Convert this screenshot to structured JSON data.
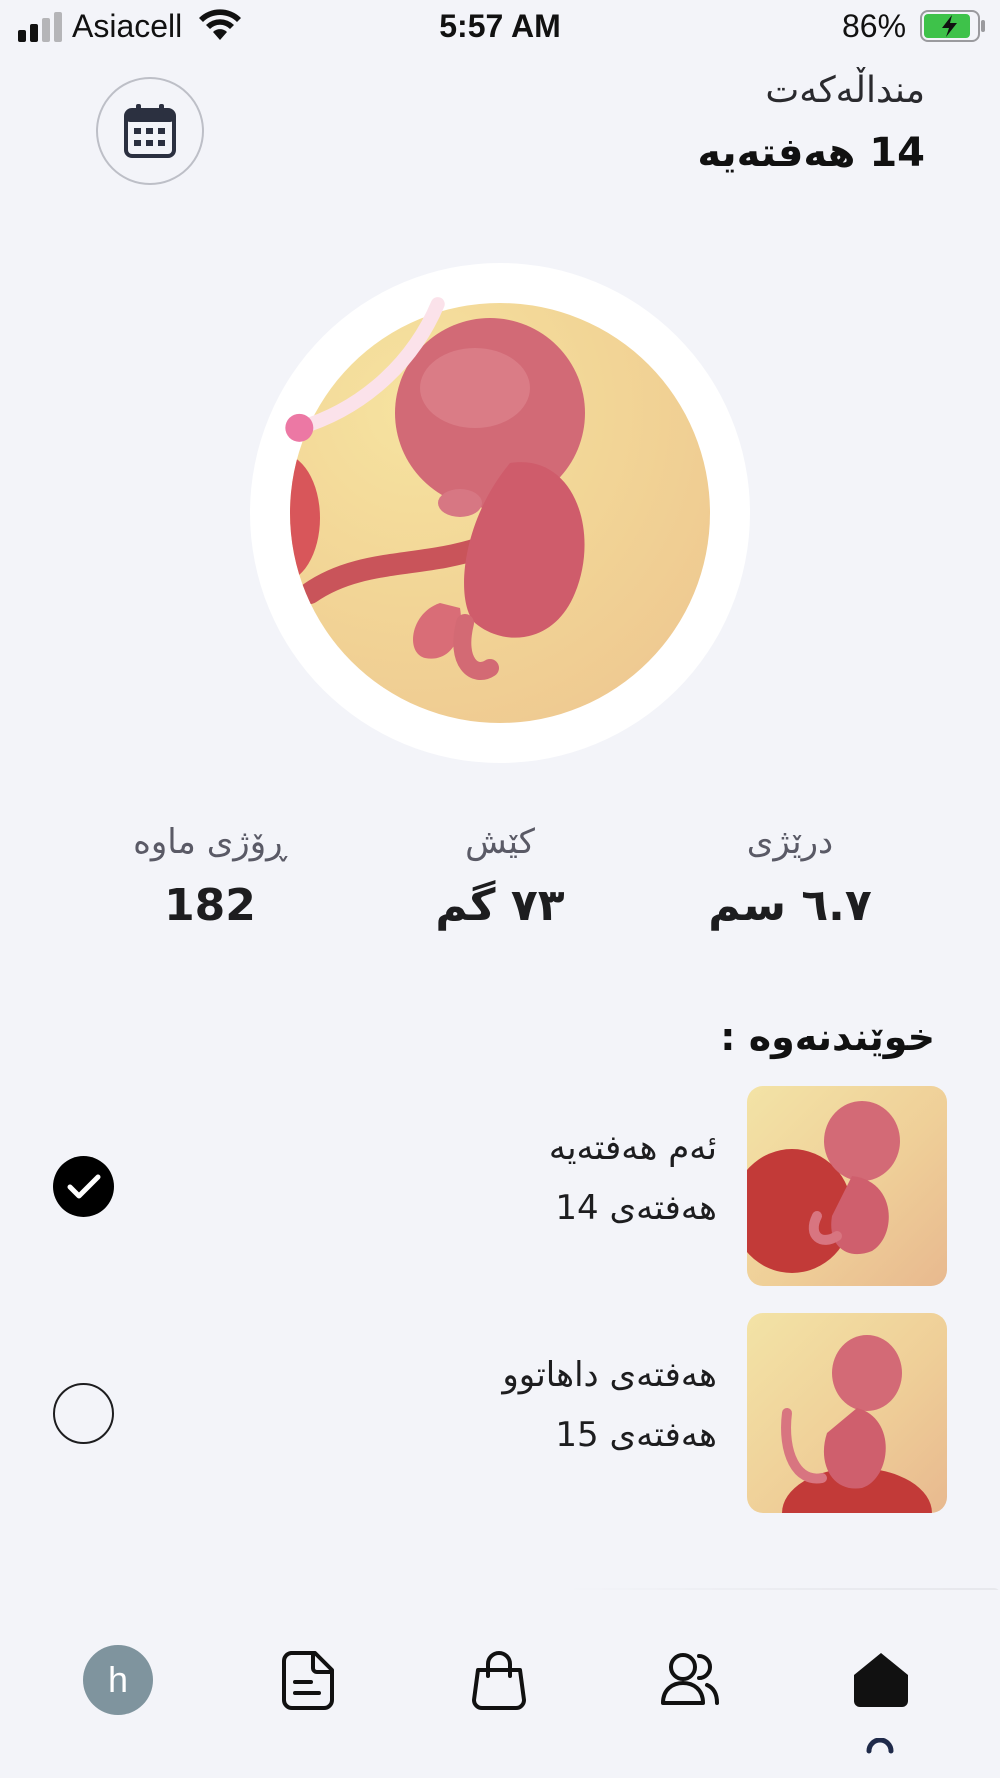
{
  "status_bar": {
    "carrier": "Asiacell",
    "time": "5:57 AM",
    "battery": "86%"
  },
  "header": {
    "subtitle": "منداڵەکەت",
    "title": "14 هەفتەیە"
  },
  "hero": {
    "progress_fraction": 0.14
  },
  "stats": {
    "days_left": {
      "label": "ڕۆژی ماوە",
      "value": "182"
    },
    "weight": {
      "label": "کێش",
      "value": "٧٣  گم"
    },
    "length": {
      "label": "درێژی",
      "value": "٦.٧  سم"
    }
  },
  "reading": {
    "title": "خوێندنەوە :",
    "items": [
      {
        "line1": "ئەم هەفتەیە",
        "line2": "هەفتەی 14",
        "done": true
      },
      {
        "line1": "هەفتەی داهاتوو",
        "line2": "هەفتەی 15",
        "done": false
      }
    ]
  },
  "nav": {
    "avatar_letter": "h",
    "items": [
      "profile",
      "notes",
      "shop",
      "community",
      "home"
    ],
    "active": "home"
  }
}
